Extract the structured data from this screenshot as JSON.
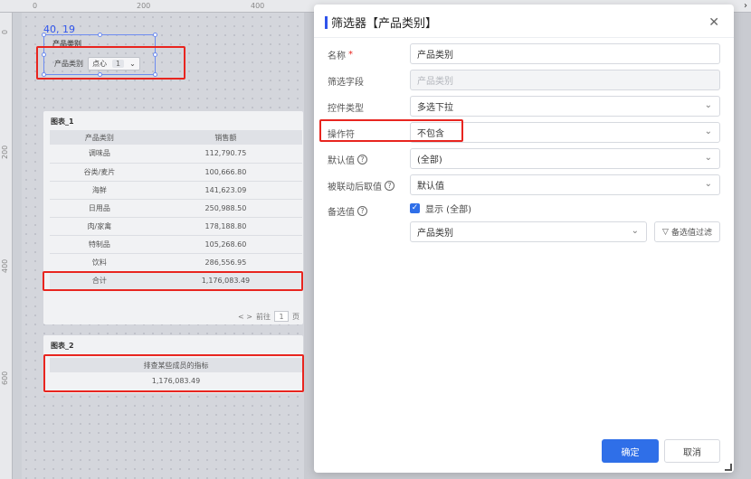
{
  "rulers": {
    "top": [
      "0",
      "200",
      "400"
    ],
    "left": [
      "0",
      "200",
      "400",
      "600"
    ]
  },
  "canvas": {
    "coord": "40, 19",
    "filter": {
      "title": "产品类别",
      "label": "产品类别",
      "value": "点心",
      "count": "1"
    },
    "chart1": {
      "title": "图表_1",
      "columns": [
        "产品类别",
        "销售额"
      ],
      "rows": [
        [
          "调味品",
          "112,790.75"
        ],
        [
          "谷类/麦片",
          "100,666.80"
        ],
        [
          "海鲜",
          "141,623.09"
        ],
        [
          "日用品",
          "250,988.50"
        ],
        [
          "肉/家禽",
          "178,188.80"
        ],
        [
          "特制品",
          "105,268.60"
        ],
        [
          "饮料",
          "286,556.95"
        ]
      ],
      "total": [
        "合计",
        "1,176,083.49"
      ],
      "pager": {
        "arrows": "< >",
        "goto": "前往",
        "page": "1",
        "unit": "页"
      }
    },
    "chart2": {
      "title": "图表_2",
      "header": "排查某些成员的指标",
      "value": "1,176,083.49"
    }
  },
  "dialog": {
    "title": "筛选器【产品类别】",
    "close_icon": "close-icon",
    "fields": {
      "name_label": "名称",
      "name_required": "*",
      "name_value": "产品类别",
      "field_label": "筛选字段",
      "field_value": "产品类别",
      "control_label": "控件类型",
      "control_value": "多选下拉",
      "operator_label": "操作符",
      "operator_value": "不包含",
      "default_label": "默认值",
      "default_value": "(全部)",
      "linked_label": "被联动后取值",
      "linked_value": "默认值",
      "options_label": "备选值",
      "show_all_label": "显示 (全部)",
      "options_source": "产品类别",
      "filter_btn": "备选值过滤"
    },
    "ok": "确定",
    "cancel": "取消"
  },
  "colors": {
    "accent": "#2f6fe8",
    "highlight": "#e8251f"
  }
}
